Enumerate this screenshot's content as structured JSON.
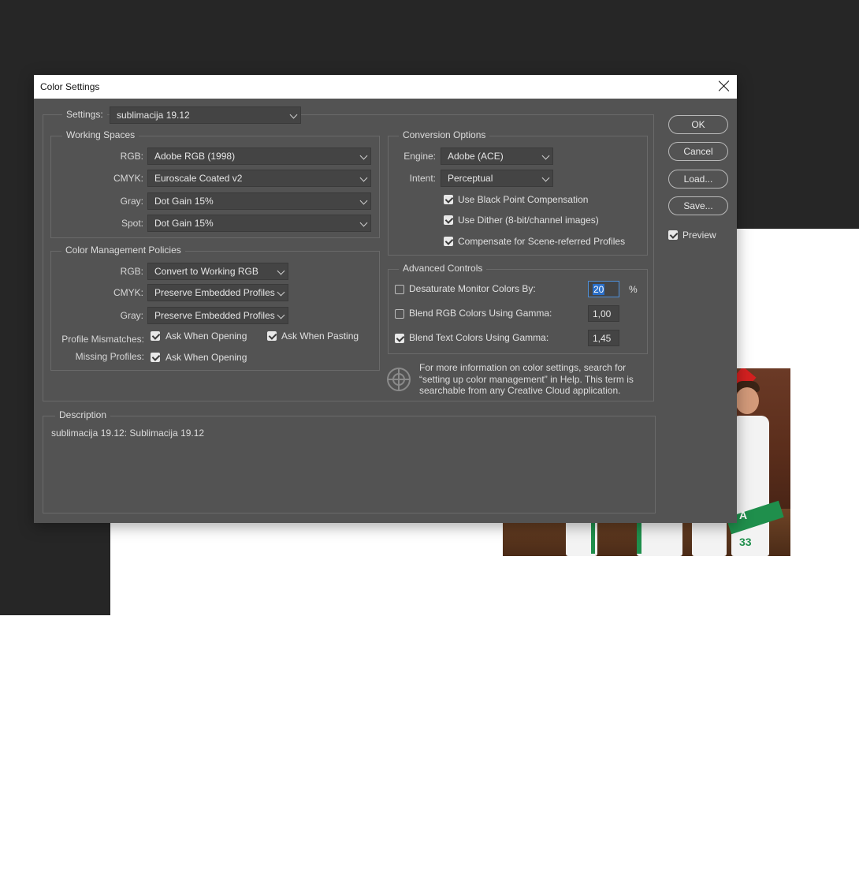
{
  "dialog": {
    "title": "Color Settings",
    "settings_label": "Settings:",
    "settings_value": "sublimacija 19.12"
  },
  "working_spaces": {
    "legend": "Working Spaces",
    "rows": [
      {
        "label": "RGB:",
        "value": "Adobe RGB (1998)"
      },
      {
        "label": "CMYK:",
        "value": "Euroscale Coated v2"
      },
      {
        "label": "Gray:",
        "value": "Dot Gain 15%"
      },
      {
        "label": "Spot:",
        "value": "Dot Gain 15%"
      }
    ]
  },
  "policies": {
    "legend": "Color Management Policies",
    "rows": [
      {
        "label": "RGB:",
        "value": "Convert to Working RGB"
      },
      {
        "label": "CMYK:",
        "value": "Preserve Embedded Profiles"
      },
      {
        "label": "Gray:",
        "value": "Preserve Embedded Profiles"
      }
    ],
    "mismatch_label": "Profile Mismatches:",
    "ask_opening": "Ask When Opening",
    "ask_pasting": "Ask When Pasting",
    "missing_label": "Missing Profiles:",
    "missing_ask_opening": "Ask When Opening"
  },
  "conversion": {
    "legend": "Conversion Options",
    "engine_label": "Engine:",
    "engine_value": "Adobe (ACE)",
    "intent_label": "Intent:",
    "intent_value": "Perceptual",
    "black_point": "Use Black Point Compensation",
    "dither": "Use Dither (8-bit/channel images)",
    "scene_referred": "Compensate for Scene-referred Profiles"
  },
  "advanced": {
    "legend": "Advanced Controls",
    "desaturate_label": "Desaturate Monitor Colors By:",
    "desaturate_value": "20",
    "percent": "%",
    "blend_rgb_label": "Blend RGB Colors Using Gamma:",
    "blend_rgb_value": "1,00",
    "blend_text_label": "Blend Text Colors Using Gamma:",
    "blend_text_value": "1,45"
  },
  "info": {
    "line1": "For more information on color settings, search for",
    "line2": "“setting up color management” in Help. This term is",
    "line3": "searchable from any Creative Cloud application."
  },
  "description": {
    "legend": "Description",
    "text": "sublimacija 19.12: Sublimacija 19.12"
  },
  "buttons": {
    "ok": "OK",
    "cancel": "Cancel",
    "load": "Load...",
    "save": "Save...",
    "preview": "Preview"
  },
  "photo": {
    "jersey_number": "33",
    "jersey_letter": "A"
  },
  "colors": {
    "dialog_bg": "#535353",
    "canvas_bg": "#262626",
    "focus_blue": "#2a6fc9"
  }
}
